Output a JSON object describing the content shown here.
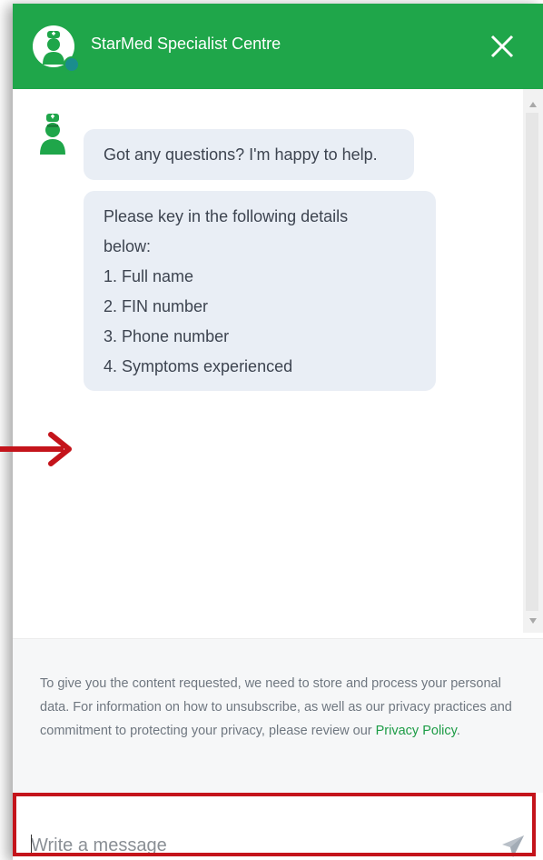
{
  "header": {
    "title": "StarMed Specialist Centre",
    "avatar_icon": "nurse-avatar-icon",
    "close_icon": "close-icon",
    "background_color": "#1fa64a"
  },
  "messages": [
    {
      "sender": "bot",
      "text": "Got any questions? I'm happy to help."
    },
    {
      "sender": "bot",
      "lines": [
        "Please key in the following details",
        "below:",
        "1. Full name",
        "2. FIN number",
        "3. Phone number",
        "4. Symptoms experienced"
      ]
    }
  ],
  "privacy": {
    "text": "To give you the content requested, we need to store and process your personal data. For information on how to unsubscribe, as well as our privacy practices and commitment to protecting your privacy, please review our ",
    "link_label": "Privacy Policy",
    "suffix": "."
  },
  "composer": {
    "placeholder": "Write a message",
    "send_icon": "send-icon"
  },
  "annotations": {
    "highlight_color": "#c4141b"
  }
}
